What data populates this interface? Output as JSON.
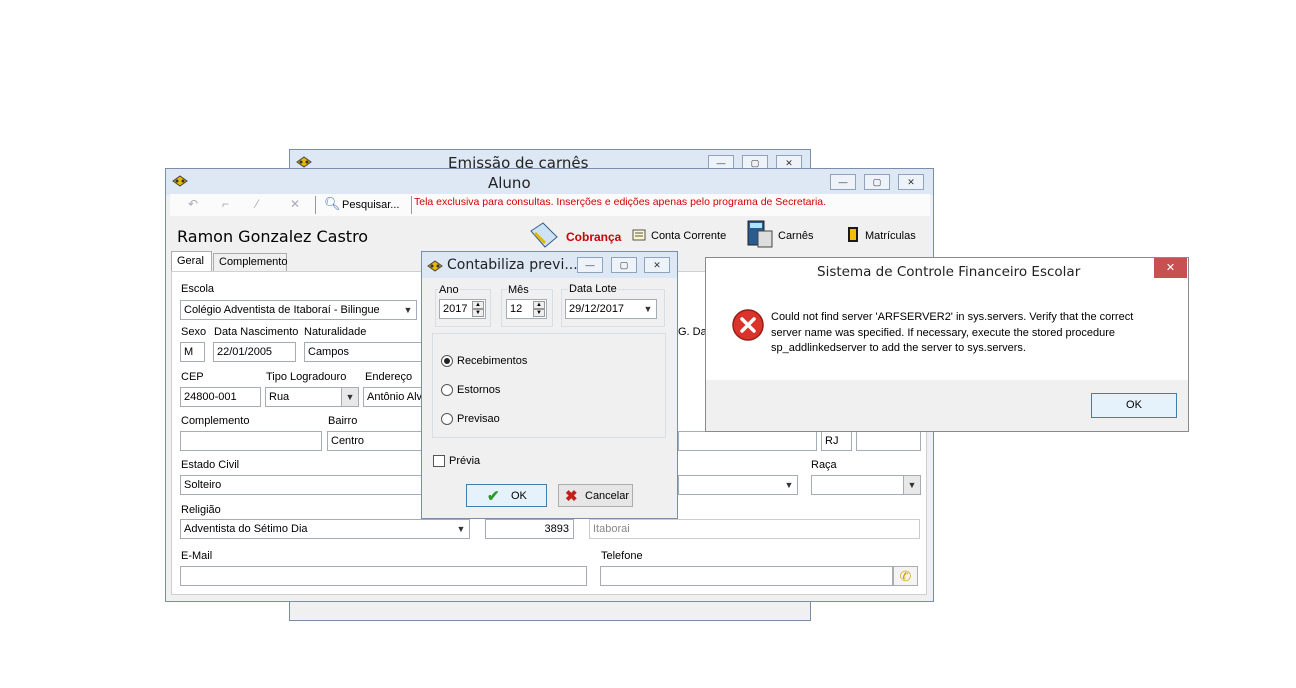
{
  "emissao": {
    "title": "Emissão de carnês"
  },
  "aluno": {
    "title": "Aluno",
    "toolbar": {
      "search_label": "Pesquisar...",
      "notice": "Tela exclusiva para consultas. Inserções e edições apenas pelo programa de Secretaria."
    },
    "student_name": "Ramon Gonzalez Castro",
    "actions": {
      "cobranca": "Cobrança",
      "conta_corrente": "Conta Corrente",
      "carnes": "Carnês",
      "matriculas": "Matrículas"
    },
    "tabs": [
      "Geral",
      "Complemento"
    ],
    "labels": {
      "escola": "Escola",
      "sexo": "Sexo",
      "data_nascimento": "Data Nascimento",
      "naturalidade": "Naturalidade",
      "cep": "CEP",
      "tipo_logradouro": "Tipo Logradouro",
      "endereco": "Endereço",
      "complemento": "Complemento",
      "bairro": "Bairro",
      "estado_civil": "Estado Civil",
      "raca": "Raça",
      "religiao": "Religião",
      "email": "E-Mail",
      "telefone": "Telefone",
      "partial_rg": "G. Da"
    },
    "values": {
      "escola": "Colégio Adventista de Itaboraí - Bilingue",
      "sexo": "M",
      "data_nascimento": "22/01/2005",
      "naturalidade": "Campos",
      "cep": "24800-001",
      "tipo_logradouro": "Rua",
      "endereco": "Antônio Alv",
      "complemento": "",
      "bairro": "Centro",
      "uf": "RJ",
      "estado_civil": "Solteiro",
      "raca": "",
      "religiao": "Adventista do Sétimo Dia",
      "cidade_codigo": "3893",
      "cidade": "Itaborai",
      "email": "",
      "telefone": ""
    }
  },
  "contabiliza": {
    "title": "Contabiliza previ...",
    "ano_label": "Ano",
    "ano_value": "2017",
    "mes_label": "Mês",
    "mes_value": "12",
    "data_lote_label": "Data Lote",
    "data_lote_value": "29/12/2017",
    "options": [
      "Recebimentos",
      "Estornos",
      "Previsao"
    ],
    "selected_option": "Recebimentos",
    "previa_label": "Prévia",
    "ok_label": "OK",
    "cancel_label": "Cancelar"
  },
  "error_dialog": {
    "title": "Sistema de Controle Financeiro Escolar",
    "message": "Could not find server 'ARFSERVER2' in sys.servers. Verify that the correct server name was specified. If necessary, execute the stored procedure sp_addlinkedserver to add the server to sys.servers.",
    "ok_label": "OK",
    "close_glyph": "✕"
  },
  "colors": {
    "notice_red": "#d40000",
    "cobranca_red": "#cc0000",
    "error_red": "#d9332c",
    "close_red": "#c75050"
  }
}
